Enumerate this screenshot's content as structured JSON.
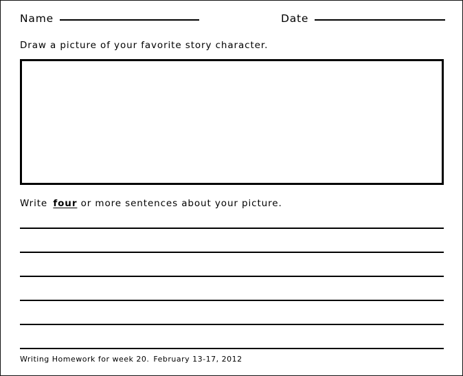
{
  "page": {
    "background_color": "#ffffff",
    "ink_color": "#000000"
  },
  "header": {
    "name_label": "Name",
    "date_label": "Date"
  },
  "instructions": {
    "draw": "Draw a picture of your favorite story character.",
    "write_prefix": "Write",
    "write_emphasis": "four",
    "write_suffix": "or more sentences about your picture."
  },
  "drawing_area": {
    "content": ""
  },
  "writing_lines": {
    "count": 6,
    "values": [
      "",
      "",
      "",
      "",
      "",
      ""
    ]
  },
  "footer": {
    "assignment": "Writing Homework for week 20.",
    "date_range": "February 13-17, 2012"
  }
}
